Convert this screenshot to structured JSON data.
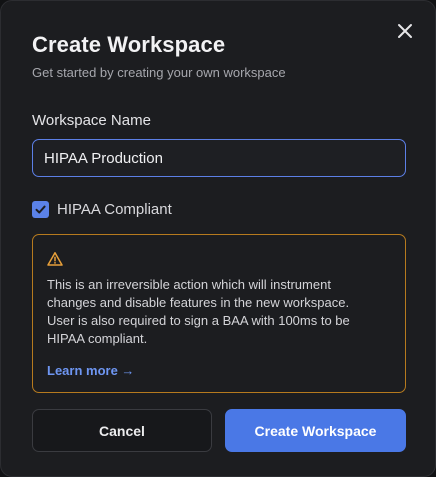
{
  "dialog": {
    "title": "Create Workspace",
    "subtitle": "Get started by creating your own workspace",
    "close_icon": "close-icon"
  },
  "form": {
    "name_label": "Workspace Name",
    "name_value": "HIPAA Production",
    "hipaa_checkbox": {
      "label": "HIPAA Compliant",
      "checked": true
    }
  },
  "warning": {
    "icon": "warning-triangle-icon",
    "text": "This is an irreversible action which will instrument changes and disable features in the new workspace. User is also required to sign a BAA with 100ms to be HIPAA compliant.",
    "link_label": "Learn more →"
  },
  "actions": {
    "cancel_label": "Cancel",
    "create_label": "Create Workspace"
  },
  "colors": {
    "accent": "#4a78e6",
    "warning": "#e8a03a",
    "background": "#1c1d20"
  }
}
